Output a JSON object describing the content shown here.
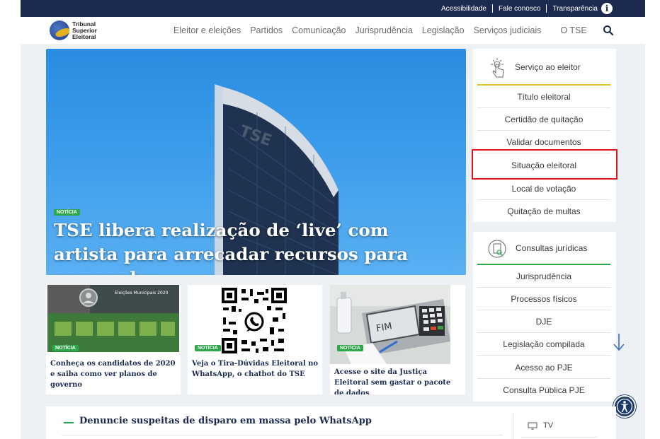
{
  "topbar": {
    "links": [
      "Acessibilidade",
      "Fale conosco",
      "Transparência"
    ],
    "info_glyph": "i"
  },
  "logo": {
    "lines": [
      "Tribunal",
      "Superior",
      "Eleitoral"
    ]
  },
  "nav": {
    "items": [
      "Eleitor e eleições",
      "Partidos",
      "Comunicação",
      "Jurisprudência",
      "Legislação",
      "Serviços judiciais",
      "O TSE"
    ],
    "search_icon": "search-icon"
  },
  "hero": {
    "tag": "NOTÍCIA",
    "title": "TSE libera realização de ‘live’ com artista para arrecadar recursos para campanha",
    "building_text": "TSE"
  },
  "cards": [
    {
      "tag": "NOTÍCIA",
      "caption": "Conheça os candidatos de 2020 e saiba como ver planos de governo",
      "image_title": "Eleições Municipais 2020"
    },
    {
      "tag": "NOTÍCIA",
      "caption": "Veja o Tira-Dúvidas Eleitoral no WhatsApp, o chatbot do TSE"
    },
    {
      "tag": "NOTÍCIA",
      "caption": "Acesse o site da Justiça Eleitoral sem gastar o pacote de dados",
      "image_text": "FIM"
    }
  ],
  "services": {
    "title": "Serviço ao eleitor",
    "items": [
      "Título eleitoral",
      "Certidão de quitação",
      "Validar documentos",
      "Situação eleitoral",
      "Local de votação",
      "Quitação de multas"
    ],
    "accent": "#e3c23a"
  },
  "juridicas": {
    "title": "Consultas jurídicas",
    "items": [
      "Jurisprudência",
      "Processos físicos",
      "DJE",
      "Legislação compilada",
      "Acesso ao PJE",
      "Consulta Pública PJE"
    ],
    "accent": "#2aa84a"
  },
  "bottom": {
    "headline": "Denuncie suspeitas de disparo em massa pelo WhatsApp",
    "tv_label": "TV"
  },
  "colors": {
    "topbar": "#1b2a4e",
    "highlight": "#e0161e",
    "tag_green": "#2aa84a"
  }
}
